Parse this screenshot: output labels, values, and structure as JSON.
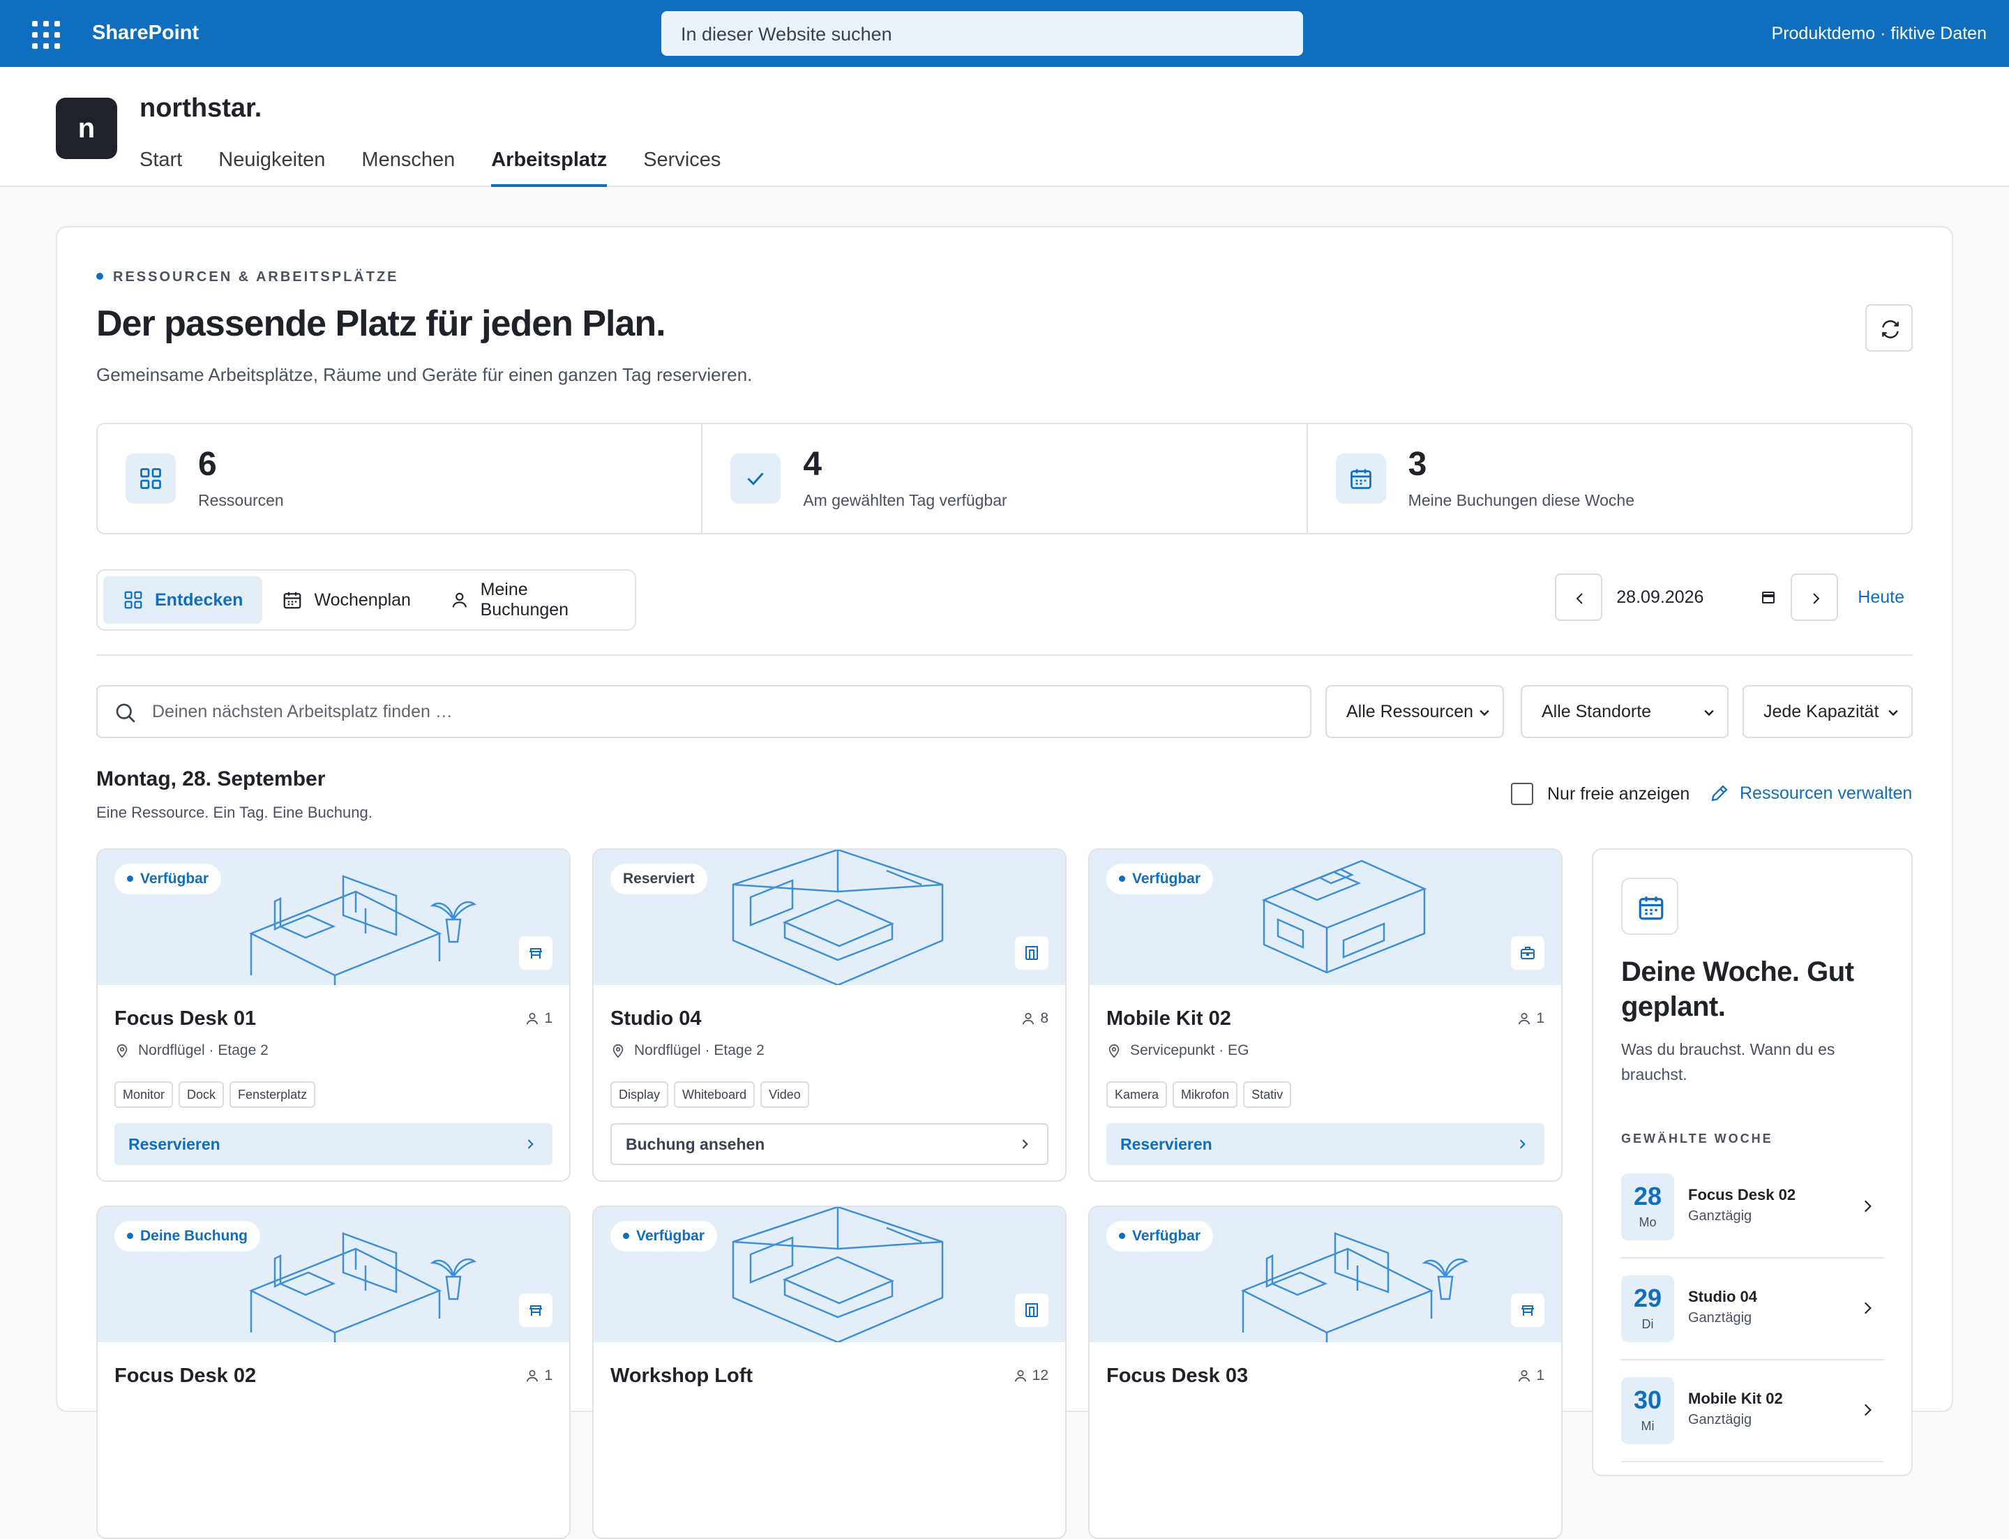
{
  "topbar": {
    "app_name": "SharePoint",
    "search_placeholder": "In dieser Website suchen",
    "tenant_label": "Produktdemo · fiktive Daten"
  },
  "site": {
    "logo_letter": "n",
    "name": "northstar.",
    "nav": [
      "Start",
      "Neuigkeiten",
      "Menschen",
      "Arbeitsplatz",
      "Services"
    ],
    "active_nav": "Arbeitsplatz"
  },
  "hero": {
    "eyebrow": "RESSOURCEN & ARBEITSPLÄTZE",
    "title": "Der passende Platz für jeden Plan.",
    "lead": "Gemeinsame Arbeitsplätze, Räume und Geräte für einen ganzen Tag reservieren."
  },
  "stats": [
    {
      "value": "6",
      "label": "Ressourcen",
      "icon": "grid-icon"
    },
    {
      "value": "4",
      "label": "Am gewählten Tag verfügbar",
      "icon": "check-icon"
    },
    {
      "value": "3",
      "label": "Meine Buchungen diese Woche",
      "icon": "calendar-icon"
    }
  ],
  "view_tabs": [
    {
      "label": "Entdecken",
      "icon": "grid-icon",
      "active": true
    },
    {
      "label": "Wochenplan",
      "icon": "calendar-icon",
      "active": false
    },
    {
      "label": "Meine Buchungen",
      "icon": "person-icon",
      "active": false
    }
  ],
  "date_picker": {
    "value": "28.09.2026",
    "today_label": "Heute"
  },
  "filters": {
    "search_placeholder": "Deinen nächsten Arbeitsplatz finden …",
    "resource_select": "Alle Ressourcen",
    "location_select": "Alle Standorte",
    "capacity_select": "Jede Kapazität"
  },
  "day": {
    "title": "Montag, 28. September",
    "subtitle": "Eine Ressource. Ein Tag. Eine Buchung.",
    "free_only_label": "Nur freie anzeigen",
    "manage_label": "Ressourcen verwalten"
  },
  "cards": [
    {
      "status": "Verfügbar",
      "status_kind": "available",
      "name": "Focus Desk 01",
      "capacity": "1",
      "location": "Nordflügel · Etage 2",
      "tags": [
        "Monitor",
        "Dock",
        "Fensterplatz"
      ],
      "action": "Reservieren",
      "action_kind": "primary",
      "type_icon": "desk-icon"
    },
    {
      "status": "Reserviert",
      "status_kind": "reserved",
      "name": "Studio 04",
      "capacity": "8",
      "location": "Nordflügel · Etage 2",
      "tags": [
        "Display",
        "Whiteboard",
        "Video"
      ],
      "action": "Buchung ansehen",
      "action_kind": "secondary",
      "type_icon": "room-icon"
    },
    {
      "status": "Verfügbar",
      "status_kind": "available",
      "name": "Mobile Kit 02",
      "capacity": "1",
      "location": "Servicepunkt · EG",
      "tags": [
        "Kamera",
        "Mikrofon",
        "Stativ"
      ],
      "action": "Reservieren",
      "action_kind": "primary",
      "type_icon": "kit-icon"
    },
    {
      "status": "Deine Buchung",
      "status_kind": "mine",
      "name": "Focus Desk 02",
      "capacity": "1",
      "type_icon": "desk-icon"
    },
    {
      "status": "Verfügbar",
      "status_kind": "available",
      "name": "Workshop Loft",
      "capacity": "12",
      "type_icon": "room-icon"
    },
    {
      "status": "Verfügbar",
      "status_kind": "available",
      "name": "Focus Desk 03",
      "capacity": "1",
      "type_icon": "desk-icon"
    }
  ],
  "week_panel": {
    "title": "Deine Woche. Gut geplant.",
    "subtitle": "Was du brauchst. Wann du es brauchst.",
    "eyebrow": "GEWÄHLTE WOCHE",
    "bookings": [
      {
        "day_num": "28",
        "day_name": "Mo",
        "name": "Focus Desk 02",
        "note": "Ganztägig"
      },
      {
        "day_num": "29",
        "day_name": "Di",
        "name": "Studio 04",
        "note": "Ganztägig"
      },
      {
        "day_num": "30",
        "day_name": "Mi",
        "name": "Mobile Kit 02",
        "note": "Ganztägig"
      }
    ]
  },
  "colors": {
    "brand": "#106ebe",
    "accent_bg": "#e4eef8",
    "text": "#1f2329"
  }
}
